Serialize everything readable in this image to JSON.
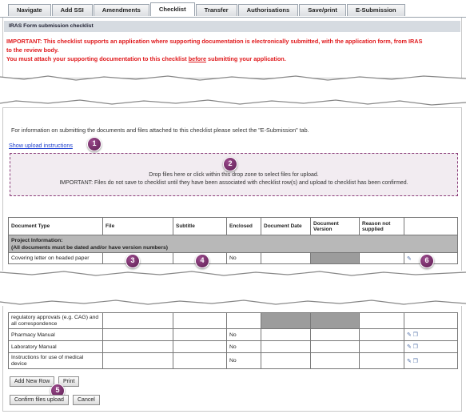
{
  "tabs": [
    "Navigate",
    "Add SSI",
    "Amendments",
    "Checklist",
    "Transfer",
    "Authorisations",
    "Save/print",
    "E-Submission"
  ],
  "panel_title": "IRAS Form submission checklist",
  "warning_line1": "IMPORTANT: This checklist supports an application where supporting documentation is electronically submitted, with the application form, from IRAS",
  "warning_line2": "to the review body.",
  "warning_line3_pre": "You must attach your supporting documentation to this checklist ",
  "warning_line3_u": "before",
  "warning_line3_post": " submitting your application.",
  "info_text": "For information on submitting the documents and files attached to this checklist please select the \"E-Submission\" tab.",
  "show_upload_link": "Show upload instructions",
  "dropzone_line1": "Drop files here or click within this drop zone to select files for upload.",
  "dropzone_line2": "IMPORTANT: Files do not save to checklist until they have been associated with checklist row(s) and upload to checklist has been confirmed.",
  "columns": [
    "Document Type",
    "File",
    "Subtitle",
    "Enclosed",
    "Document Date",
    "Document Version",
    "Reason not supplied"
  ],
  "section_label": "Project Information:",
  "section_note": "(All documents must be dated and/or have version numbers)",
  "row_covering": {
    "type": "Covering letter on headed paper",
    "enclosed": "No"
  },
  "row_regulatory": {
    "type": "regulatory approvals (e.g. CAG) and all correspondence"
  },
  "rows_bottom": [
    {
      "type": "Pharmacy Manual",
      "enclosed": "No"
    },
    {
      "type": "Laboratory Manual",
      "enclosed": "No"
    },
    {
      "type": "Instructions for use of medical device",
      "enclosed": "No"
    }
  ],
  "buttons": {
    "add_row": "Add New Row",
    "print": "Print",
    "confirm": "Confirm files upload",
    "cancel": "Cancel"
  },
  "badges": [
    "1",
    "2",
    "3",
    "4",
    "5",
    "6"
  ],
  "colors": {
    "warning": "#e0191c",
    "badge": "#7a2c6c",
    "dropzone_border": "#8a3b78",
    "section_bg": "#b8b8b8"
  }
}
